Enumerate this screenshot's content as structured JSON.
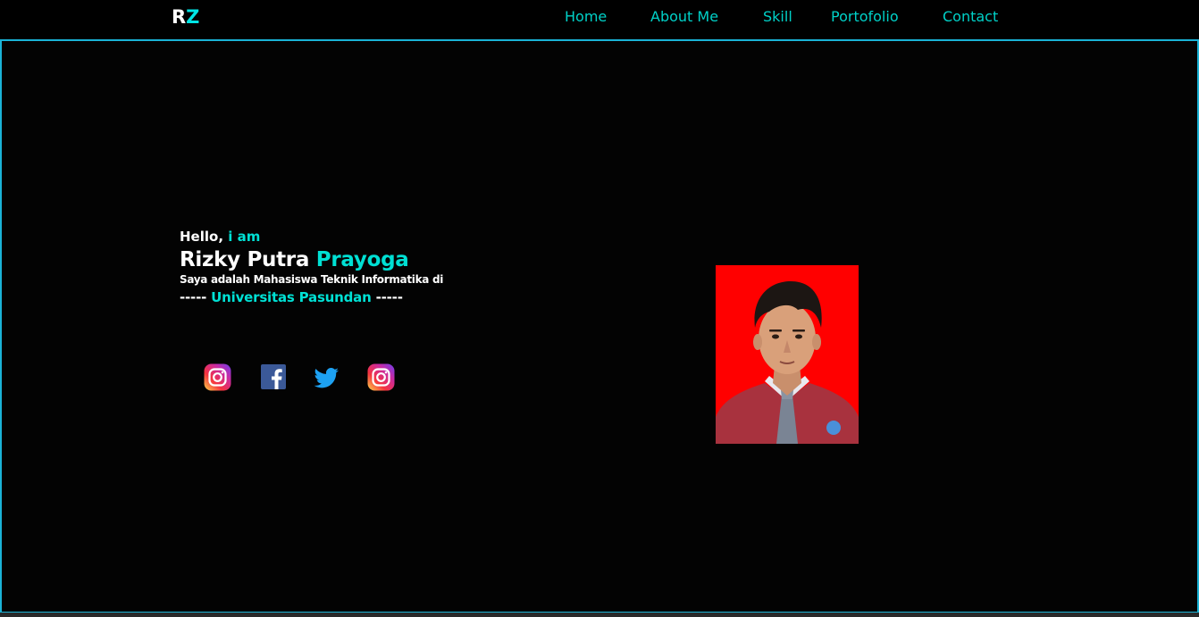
{
  "nav": {
    "logo_first": "R",
    "logo_second": "Z",
    "links": [
      "Home",
      "About Me",
      "Skill",
      "Portofolio",
      "Contact"
    ]
  },
  "hero": {
    "greeting_prefix": "Hello,",
    "greeting_accent": "i am",
    "name_first": "Rizky Putra",
    "name_accent": "Prayoga",
    "description": "Saya adalah Mahasiswa Teknik Informatika di",
    "univ_prefix": "-----",
    "univ_name": "Universitas Pasundan",
    "univ_suffix": "-----"
  },
  "socials": [
    "instagram-icon",
    "facebook-icon",
    "twitter-icon",
    "instagram-icon"
  ],
  "colors": {
    "accent": "#00e0d4",
    "nav_link": "#00d1c8",
    "border": "#1ab3d6",
    "background": "#000000",
    "photo_bg": "#ff0000"
  }
}
